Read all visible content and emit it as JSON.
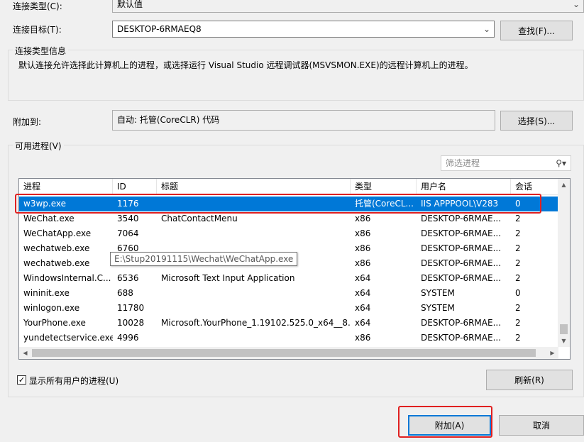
{
  "connection_type": {
    "label": "连接类型(C):",
    "value": "默认值"
  },
  "connection_target": {
    "label": "连接目标(T):",
    "value": "DESKTOP-6RMAEQ8",
    "find_button": "查找(F)..."
  },
  "connection_info": {
    "title": "连接类型信息",
    "text": "默认连接允许选择此计算机上的进程，或选择运行 Visual Studio 远程调试器(MSVSMON.EXE)的远程计算机上的进程。"
  },
  "attach_to": {
    "label": "附加到:",
    "value": "自动: 托管(CoreCLR) 代码",
    "select_button": "选择(S)..."
  },
  "available_processes": {
    "title": "可用进程(V)",
    "filter_placeholder": "筛选进程",
    "columns": [
      "进程",
      "ID",
      "标题",
      "类型",
      "用户名",
      "会话"
    ],
    "rows": [
      {
        "process": "w3wp.exe",
        "id": "1176",
        "title": "",
        "type": "托管(CoreCL...",
        "user": "IIS APPPOOL\\V283",
        "session": "0",
        "selected": true
      },
      {
        "process": "WeChat.exe",
        "id": "3540",
        "title": "ChatContactMenu",
        "type": "x86",
        "user": "DESKTOP-6RMAE...",
        "session": "2"
      },
      {
        "process": "WeChatApp.exe",
        "id": "7064",
        "title": "",
        "type": "x86",
        "user": "DESKTOP-6RMAE...",
        "session": "2"
      },
      {
        "process": "wechatweb.exe",
        "id": "6760",
        "title": "",
        "type": "x86",
        "user": "DESKTOP-6RMAE...",
        "session": "2"
      },
      {
        "process": "wechatweb.exe",
        "id": "",
        "title": "",
        "type": "x86",
        "user": "DESKTOP-6RMAE...",
        "session": "2"
      },
      {
        "process": "WindowsInternal.C...",
        "id": "6536",
        "title": "Microsoft Text Input Application",
        "type": "x64",
        "user": "DESKTOP-6RMAE...",
        "session": "2"
      },
      {
        "process": "wininit.exe",
        "id": "688",
        "title": "",
        "type": "x64",
        "user": "SYSTEM",
        "session": "0"
      },
      {
        "process": "winlogon.exe",
        "id": "11780",
        "title": "",
        "type": "x64",
        "user": "SYSTEM",
        "session": "2"
      },
      {
        "process": "YourPhone.exe",
        "id": "10028",
        "title": "Microsoft.YourPhone_1.19102.525.0_x64__8...",
        "type": "x64",
        "user": "DESKTOP-6RMAE...",
        "session": "2"
      },
      {
        "process": "yundetectservice.exe",
        "id": "4996",
        "title": "",
        "type": "x86",
        "user": "DESKTOP-6RMAE...",
        "session": "2"
      }
    ],
    "tooltip": "E:\\Stup20191115\\Wechat\\WeChatApp.exe"
  },
  "show_all_users": {
    "label": "显示所有用户的进程(U)",
    "checked": true
  },
  "refresh_button": "刷新(R)",
  "attach_button": "附加(A)",
  "cancel_button": "取消"
}
